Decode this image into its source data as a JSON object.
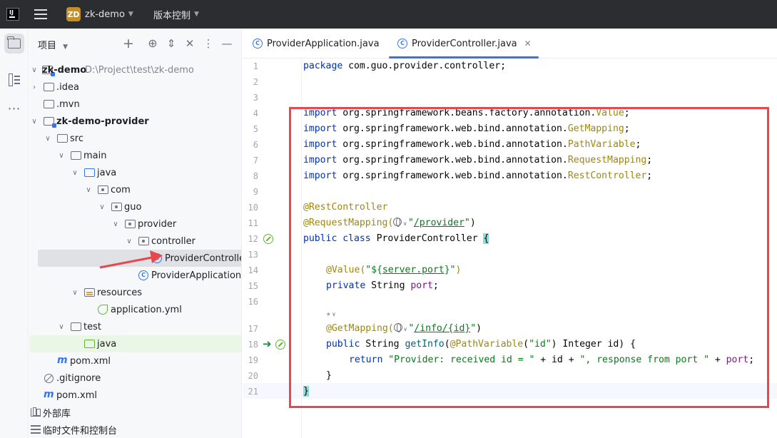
{
  "titlebar": {
    "logo_text": "IJ",
    "project_badge": "ZD",
    "project_name": "zk-demo",
    "vcs_label": "版本控制"
  },
  "panel": {
    "title": "项目"
  },
  "tree": [
    {
      "label": "zk-demo",
      "path": "D:\\Project\\test\\zk-demo"
    },
    {
      "label": ".idea"
    },
    {
      "label": ".mvn"
    },
    {
      "label": "zk-demo-provider"
    },
    {
      "label": "src"
    },
    {
      "label": "main"
    },
    {
      "label": "java"
    },
    {
      "label": "com"
    },
    {
      "label": "guo"
    },
    {
      "label": "provider"
    },
    {
      "label": "controller"
    },
    {
      "label": "ProviderController"
    },
    {
      "label": "ProviderApplication"
    },
    {
      "label": "resources"
    },
    {
      "label": "application.yml"
    },
    {
      "label": "test"
    },
    {
      "label": "java"
    },
    {
      "label": "pom.xml",
      "icon": "m"
    },
    {
      "label": ".gitignore"
    },
    {
      "label": "pom.xml",
      "icon": "m"
    },
    {
      "label": "外部库"
    },
    {
      "label": "临时文件和控制台"
    }
  ],
  "tabs": [
    {
      "label": "ProviderApplication.java"
    },
    {
      "label": "ProviderController.java"
    }
  ],
  "class_icon_letter": "C",
  "line_numbers": [
    "1",
    "2",
    "3",
    "4",
    "5",
    "6",
    "7",
    "8",
    "9",
    "10",
    "11",
    "12",
    "13",
    "14",
    "15",
    "16",
    "17",
    "18",
    "19",
    "20",
    "21"
  ],
  "code": {
    "l1_kw": "package",
    "l1_rest": " com.guo.provider.controller;",
    "import_kw": "import",
    "l4_pkg": " org.springframework.beans.factory.annotation.",
    "l4_cls": "Value",
    "l5_pkg": " org.springframework.web.bind.annotation.",
    "l5_cls": "GetMapping",
    "l6_pkg": " org.springframework.web.bind.annotation.",
    "l6_cls": "PathVariable",
    "l7_pkg": " org.springframework.web.bind.annotation.",
    "l7_cls": "RequestMapping",
    "l8_pkg": " org.springframework.web.bind.annotation.",
    "l8_cls": "RestController",
    "l10_ann": "@RestController",
    "l11_ann": "@RequestMapping(",
    "l11_q1": "\"",
    "l11_str": "/provider",
    "l11_q2": "\"",
    "l11_end": ")",
    "l12_kw": "public class",
    "l12_name": " ProviderController ",
    "l12_brace": "{",
    "l14_ann": "@Value(",
    "l14_q1": "\"${",
    "l14_str": "server.port",
    "l14_q2": "}\"",
    "l14_end": ")",
    "l15_kw": "private",
    "l15_type": " String ",
    "l15_field": "port",
    "l15_end": ";",
    "l17_ann": "@GetMapping(",
    "l17_q1": "\"",
    "l17_str": "/info/{id}",
    "l17_q2": "\"",
    "l17_end": ")",
    "l18_kw": "public",
    "l18_a": " String ",
    "l18_method": "getInfo",
    "l18_b": "(",
    "l18_ann": "@PathVariable",
    "l18_c": "(",
    "l18_str": "\"id\"",
    "l18_d": ") Integer id) {",
    "l19_kw": "return",
    "l19_s1": " \"Provider: received id = \"",
    "l19_a": " + id + ",
    "l19_s2": "\", response from port \"",
    "l19_b": " + ",
    "l19_field": "port",
    "l19_end": ";",
    "l20": "}",
    "l21": "}"
  },
  "colors": {
    "accent": "#3574f0",
    "annotation_box": "#e5484d",
    "keyword": "#0033b3",
    "string": "#067d17"
  }
}
